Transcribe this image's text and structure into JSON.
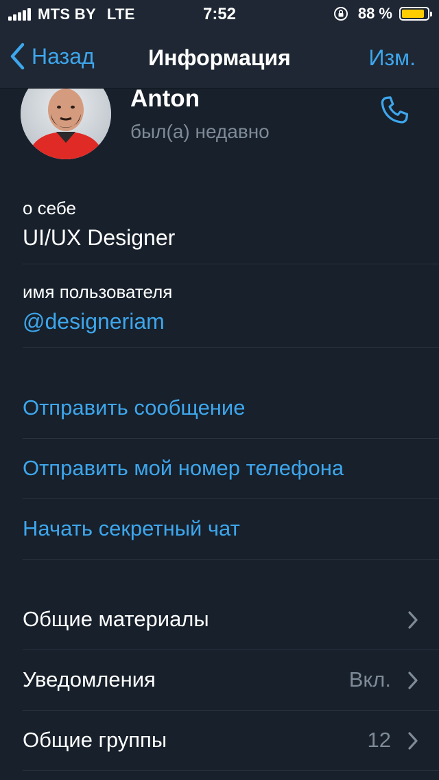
{
  "status_bar": {
    "carrier": "MTS BY",
    "network": "LTE",
    "time": "7:52",
    "battery_percent": "88 %",
    "battery_level": 0.88,
    "battery_color": "#ffcc00"
  },
  "nav": {
    "back_label": "Назад",
    "title": "Информация",
    "edit_label": "Изм."
  },
  "profile": {
    "name": "Anton",
    "status": "был(а) недавно"
  },
  "info": {
    "about_label": "о себе",
    "about_value": "UI/UX Designer",
    "username_label": "имя пользователя",
    "username_value": "@designeriam"
  },
  "actions": [
    {
      "label": "Отправить сообщение"
    },
    {
      "label": "Отправить мой номер телефона"
    },
    {
      "label": "Начать секретный чат"
    }
  ],
  "settings": [
    {
      "label": "Общие материалы",
      "value": ""
    },
    {
      "label": "Уведомления",
      "value": "Вкл."
    },
    {
      "label": "Общие группы",
      "value": "12"
    }
  ],
  "colors": {
    "accent": "#3ea6ec",
    "background": "#17202b",
    "bar": "#1e2733",
    "secondary_text": "#7e8a97"
  }
}
